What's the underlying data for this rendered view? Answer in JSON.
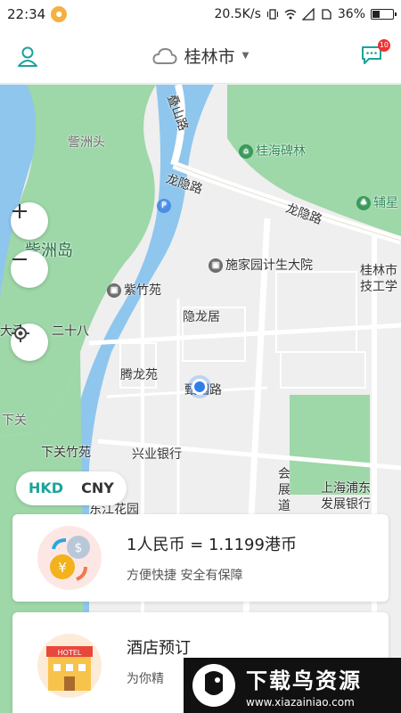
{
  "status_bar": {
    "time": "22:34",
    "network_speed": "20.5K/s",
    "battery": "36%",
    "battery_level": 0.36
  },
  "header": {
    "city": "桂林市",
    "message_badge": "10"
  },
  "map": {
    "labels": {
      "zhouzhoutou": "訾洲头",
      "zhouzhoudao": "訾洲岛",
      "road_top": "叠山路",
      "guihaibeilin": "桂海碑林",
      "longyinlu_1": "龙隐路",
      "longyinlu_2": "龙隐路",
      "fuxing": "辅星",
      "shijiayuan": "施家园计生大院",
      "guilin_college": "桂林市技工学",
      "zizhuyuan": "紫竹苑",
      "yinlongju": "隐龙居",
      "dahe": "大河",
      "ershiba": "二十八",
      "tenglongyuan": "腾龙苑",
      "street_mid": "甄园路",
      "xiaguan": "下关",
      "xiaguanzhuyuan": "下关竹苑",
      "xingye_bank": "兴业银行",
      "huizhandao": "会展道",
      "shanghai_bank": "上海浦东发展银行",
      "dongjiang": "东江花园",
      "parking": "P"
    }
  },
  "currency_toggle": {
    "hkd": "HKD",
    "cny": "CNY"
  },
  "cards": {
    "rate": {
      "title": "1人民币 = 1.1199港币",
      "subtitle": "方便快捷 安全有保障"
    },
    "hotel": {
      "title": "酒店预订",
      "subtitle": "为你精",
      "icon_text": "HOTEL"
    }
  },
  "watermark": {
    "main": "下载鸟资源",
    "url": "www.xiazainiao.com"
  }
}
